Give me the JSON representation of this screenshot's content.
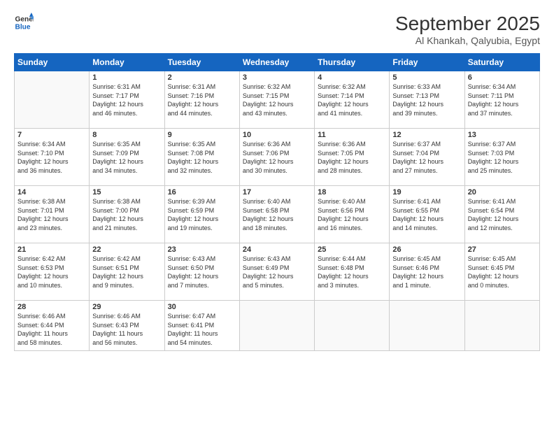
{
  "header": {
    "logo_line1": "General",
    "logo_line2": "Blue",
    "month": "September 2025",
    "location": "Al Khankah, Qalyubia, Egypt"
  },
  "weekdays": [
    "Sunday",
    "Monday",
    "Tuesday",
    "Wednesday",
    "Thursday",
    "Friday",
    "Saturday"
  ],
  "weeks": [
    [
      {
        "day": "",
        "info": ""
      },
      {
        "day": "1",
        "info": "Sunrise: 6:31 AM\nSunset: 7:17 PM\nDaylight: 12 hours\nand 46 minutes."
      },
      {
        "day": "2",
        "info": "Sunrise: 6:31 AM\nSunset: 7:16 PM\nDaylight: 12 hours\nand 44 minutes."
      },
      {
        "day": "3",
        "info": "Sunrise: 6:32 AM\nSunset: 7:15 PM\nDaylight: 12 hours\nand 43 minutes."
      },
      {
        "day": "4",
        "info": "Sunrise: 6:32 AM\nSunset: 7:14 PM\nDaylight: 12 hours\nand 41 minutes."
      },
      {
        "day": "5",
        "info": "Sunrise: 6:33 AM\nSunset: 7:13 PM\nDaylight: 12 hours\nand 39 minutes."
      },
      {
        "day": "6",
        "info": "Sunrise: 6:34 AM\nSunset: 7:11 PM\nDaylight: 12 hours\nand 37 minutes."
      }
    ],
    [
      {
        "day": "7",
        "info": "Sunrise: 6:34 AM\nSunset: 7:10 PM\nDaylight: 12 hours\nand 36 minutes."
      },
      {
        "day": "8",
        "info": "Sunrise: 6:35 AM\nSunset: 7:09 PM\nDaylight: 12 hours\nand 34 minutes."
      },
      {
        "day": "9",
        "info": "Sunrise: 6:35 AM\nSunset: 7:08 PM\nDaylight: 12 hours\nand 32 minutes."
      },
      {
        "day": "10",
        "info": "Sunrise: 6:36 AM\nSunset: 7:06 PM\nDaylight: 12 hours\nand 30 minutes."
      },
      {
        "day": "11",
        "info": "Sunrise: 6:36 AM\nSunset: 7:05 PM\nDaylight: 12 hours\nand 28 minutes."
      },
      {
        "day": "12",
        "info": "Sunrise: 6:37 AM\nSunset: 7:04 PM\nDaylight: 12 hours\nand 27 minutes."
      },
      {
        "day": "13",
        "info": "Sunrise: 6:37 AM\nSunset: 7:03 PM\nDaylight: 12 hours\nand 25 minutes."
      }
    ],
    [
      {
        "day": "14",
        "info": "Sunrise: 6:38 AM\nSunset: 7:01 PM\nDaylight: 12 hours\nand 23 minutes."
      },
      {
        "day": "15",
        "info": "Sunrise: 6:38 AM\nSunset: 7:00 PM\nDaylight: 12 hours\nand 21 minutes."
      },
      {
        "day": "16",
        "info": "Sunrise: 6:39 AM\nSunset: 6:59 PM\nDaylight: 12 hours\nand 19 minutes."
      },
      {
        "day": "17",
        "info": "Sunrise: 6:40 AM\nSunset: 6:58 PM\nDaylight: 12 hours\nand 18 minutes."
      },
      {
        "day": "18",
        "info": "Sunrise: 6:40 AM\nSunset: 6:56 PM\nDaylight: 12 hours\nand 16 minutes."
      },
      {
        "day": "19",
        "info": "Sunrise: 6:41 AM\nSunset: 6:55 PM\nDaylight: 12 hours\nand 14 minutes."
      },
      {
        "day": "20",
        "info": "Sunrise: 6:41 AM\nSunset: 6:54 PM\nDaylight: 12 hours\nand 12 minutes."
      }
    ],
    [
      {
        "day": "21",
        "info": "Sunrise: 6:42 AM\nSunset: 6:53 PM\nDaylight: 12 hours\nand 10 minutes."
      },
      {
        "day": "22",
        "info": "Sunrise: 6:42 AM\nSunset: 6:51 PM\nDaylight: 12 hours\nand 9 minutes."
      },
      {
        "day": "23",
        "info": "Sunrise: 6:43 AM\nSunset: 6:50 PM\nDaylight: 12 hours\nand 7 minutes."
      },
      {
        "day": "24",
        "info": "Sunrise: 6:43 AM\nSunset: 6:49 PM\nDaylight: 12 hours\nand 5 minutes."
      },
      {
        "day": "25",
        "info": "Sunrise: 6:44 AM\nSunset: 6:48 PM\nDaylight: 12 hours\nand 3 minutes."
      },
      {
        "day": "26",
        "info": "Sunrise: 6:45 AM\nSunset: 6:46 PM\nDaylight: 12 hours\nand 1 minute."
      },
      {
        "day": "27",
        "info": "Sunrise: 6:45 AM\nSunset: 6:45 PM\nDaylight: 12 hours\nand 0 minutes."
      }
    ],
    [
      {
        "day": "28",
        "info": "Sunrise: 6:46 AM\nSunset: 6:44 PM\nDaylight: 11 hours\nand 58 minutes."
      },
      {
        "day": "29",
        "info": "Sunrise: 6:46 AM\nSunset: 6:43 PM\nDaylight: 11 hours\nand 56 minutes."
      },
      {
        "day": "30",
        "info": "Sunrise: 6:47 AM\nSunset: 6:41 PM\nDaylight: 11 hours\nand 54 minutes."
      },
      {
        "day": "",
        "info": ""
      },
      {
        "day": "",
        "info": ""
      },
      {
        "day": "",
        "info": ""
      },
      {
        "day": "",
        "info": ""
      }
    ]
  ]
}
